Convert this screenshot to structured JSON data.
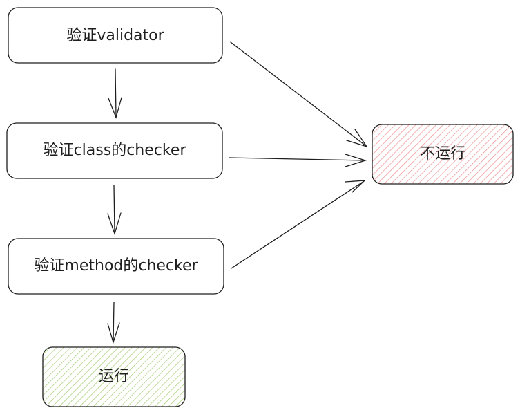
{
  "diagram": {
    "nodes": {
      "validator": {
        "label": "验证validator"
      },
      "class_checker": {
        "label": "验证class的checker"
      },
      "method_checker": {
        "label": "验证method的checker"
      },
      "not_run": {
        "label": "不运行",
        "fill": "#ffc9c9",
        "hatch": "#e03131"
      },
      "run": {
        "label": "运行",
        "fill": "#d8f5a2",
        "hatch": "#66a80f"
      }
    },
    "edges": [
      {
        "from": "validator",
        "to": "class_checker"
      },
      {
        "from": "class_checker",
        "to": "method_checker"
      },
      {
        "from": "method_checker",
        "to": "run"
      },
      {
        "from": "validator",
        "to": "not_run"
      },
      {
        "from": "class_checker",
        "to": "not_run"
      },
      {
        "from": "method_checker",
        "to": "not_run"
      }
    ],
    "stroke": "#1e1e1e"
  }
}
